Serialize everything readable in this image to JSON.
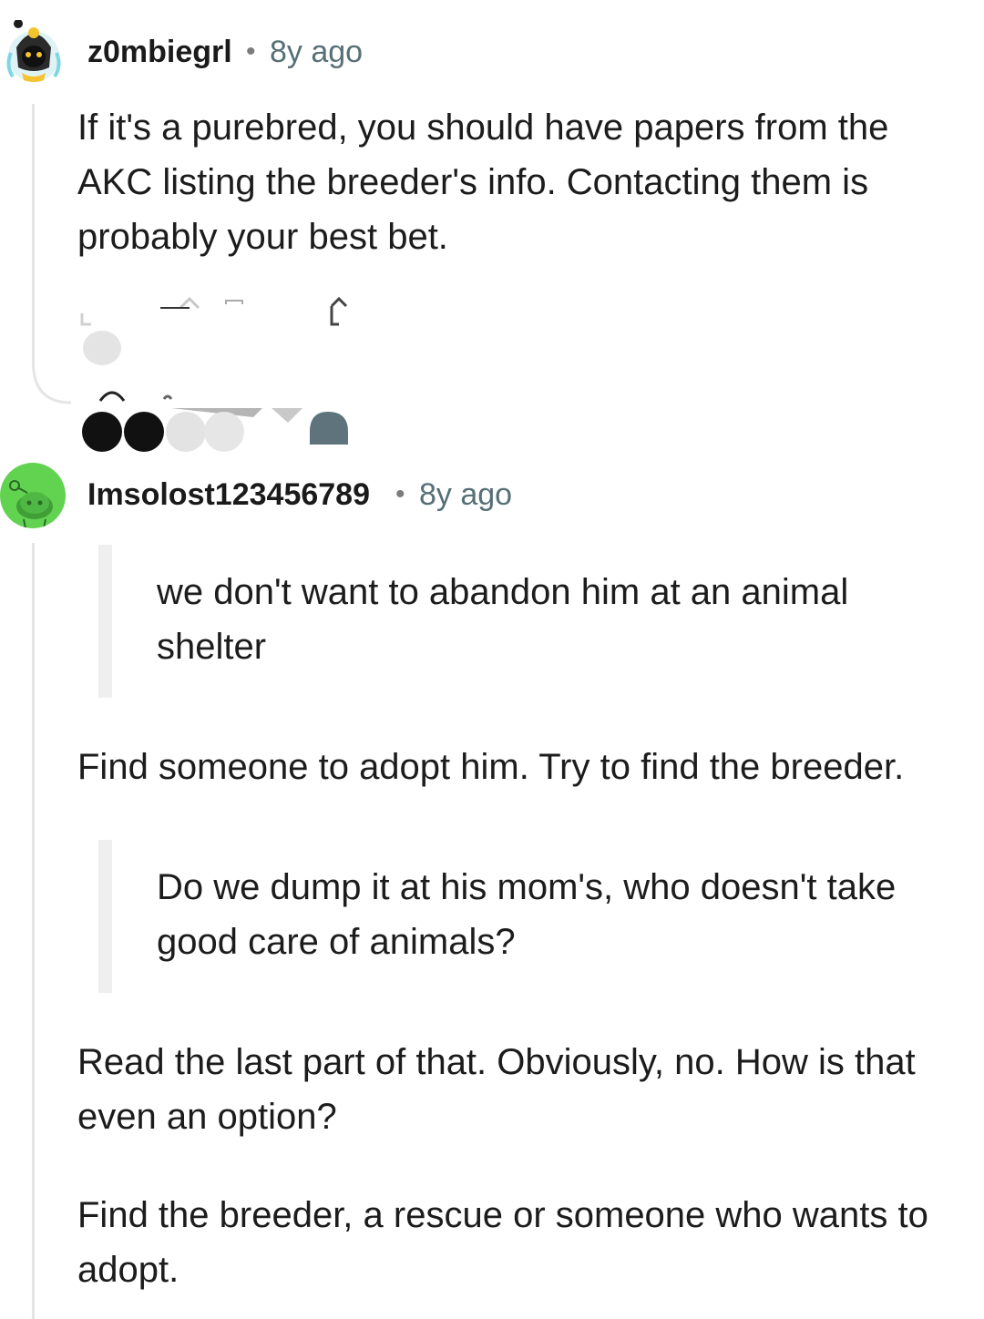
{
  "comments": [
    {
      "username": "z0mbiegrl",
      "separator": "•",
      "age": "8y ago",
      "avatar_icon": "snoo-avatar-icon",
      "paragraphs": [
        "If it's a purebred, you should have papers from the AKC listing the breeder's info. Contacting them is probably your best bet."
      ]
    },
    {
      "username": "Imsolost123456789",
      "separator": "•",
      "age": "8y ago",
      "avatar_icon": "default-snoo-avatar-icon",
      "blocks": [
        {
          "type": "quote",
          "text": "we don't want to abandon him at an animal shelter"
        },
        {
          "type": "text",
          "text": "Find someone to adopt him. Try to find the breeder."
        },
        {
          "type": "quote",
          "text": "Do we dump it at his mom's, who doesn't take good care of animals?"
        },
        {
          "type": "text",
          "text": "Read the last part of that. Obviously, no. How is that even an option?"
        },
        {
          "type": "text",
          "text": "Find the breeder, a rescue or someone who wants to adopt."
        }
      ]
    }
  ],
  "colors": {
    "username": "#1a1a1b",
    "meta": "#576f76",
    "thread_line": "#e5e5e5",
    "quote_bar": "#efefef",
    "avatar2_bg": "#62d251"
  }
}
